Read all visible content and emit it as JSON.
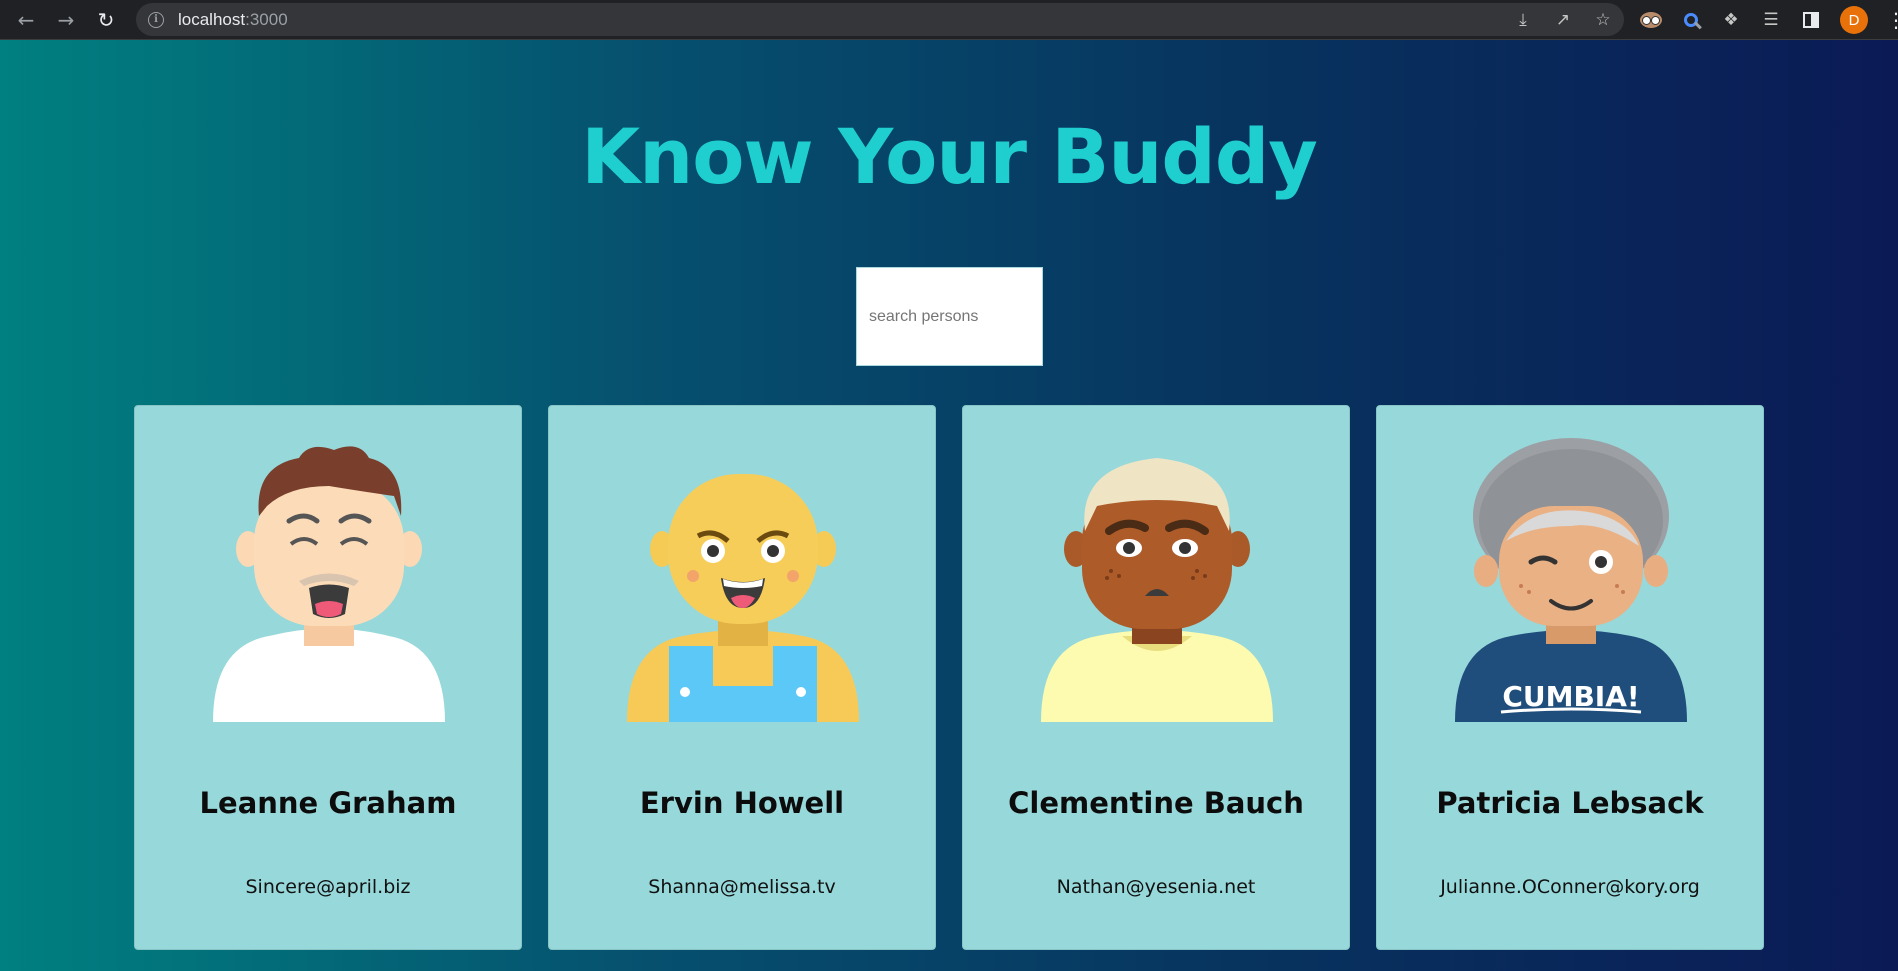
{
  "browser": {
    "url_host": "localhost",
    "url_port": ":3000",
    "profile_initial": "D"
  },
  "page": {
    "title": "Know Your Buddy",
    "search_placeholder": "search persons"
  },
  "cards": [
    {
      "name": "Leanne Graham",
      "email": "Sincere@april.biz"
    },
    {
      "name": "Ervin Howell",
      "email": "Shanna@melissa.tv"
    },
    {
      "name": "Clementine Bauch",
      "email": "Nathan@yesenia.net"
    },
    {
      "name": "Patricia Lebsack",
      "email": "Julianne.OConner@kory.org",
      "shirt_text": "CUMBIA!"
    }
  ],
  "colors": {
    "title": "#1fcfd0",
    "card_bg": "#97d8da",
    "gradient_start": "#008080",
    "gradient_end": "#0b1a55"
  }
}
